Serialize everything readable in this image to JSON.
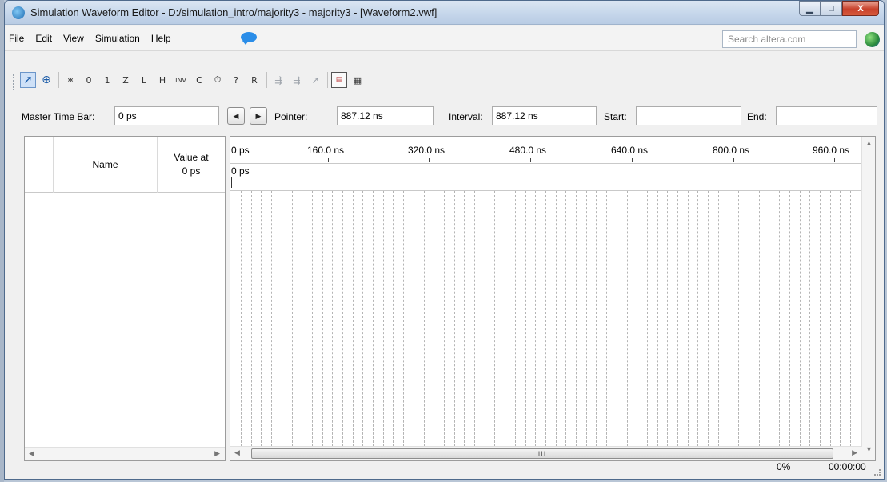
{
  "window": {
    "title": "Simulation Waveform Editor - D:/simulation_intro/majority3 - majority3 - [Waveform2.vwf]",
    "minimize_glyph": "▁",
    "maximize_glyph": "□",
    "close_glyph": "X"
  },
  "menu": {
    "items": [
      {
        "label": "File"
      },
      {
        "label": "Edit"
      },
      {
        "label": "View"
      },
      {
        "label": "Simulation"
      },
      {
        "label": "Help"
      }
    ],
    "search_placeholder": "Search altera.com"
  },
  "toolbar": {
    "tools": [
      {
        "name": "selection-tool",
        "glyph": "➚"
      },
      {
        "name": "zoom-tool",
        "glyph": "⊕"
      },
      {
        "name": "forcing-unknown",
        "glyph": "⨳"
      },
      {
        "name": "forcing-low",
        "glyph": "0"
      },
      {
        "name": "forcing-high",
        "glyph": "1"
      },
      {
        "name": "high-impedance",
        "glyph": "Z"
      },
      {
        "name": "weak-low",
        "glyph": "L"
      },
      {
        "name": "weak-high",
        "glyph": "H"
      },
      {
        "name": "invert",
        "glyph": "INV"
      },
      {
        "name": "count-value",
        "glyph": "C"
      },
      {
        "name": "clock",
        "glyph": "⏱"
      },
      {
        "name": "arbitrary-value",
        "glyph": "?"
      },
      {
        "name": "random-value",
        "glyph": "R"
      },
      {
        "name": "functional-simulation",
        "glyph": "⇶"
      },
      {
        "name": "timing-simulation",
        "glyph": "⇶"
      },
      {
        "name": "netlist-sim",
        "glyph": "↗"
      },
      {
        "name": "simulation-report",
        "glyph": "▤"
      },
      {
        "name": "grid-snap",
        "glyph": "▦"
      }
    ]
  },
  "controls": {
    "master_time_bar_label": "Master Time Bar:",
    "master_time_bar_value": "0 ps",
    "prev_glyph": "◀",
    "next_glyph": "▶",
    "pointer_label": "Pointer:",
    "pointer_value": "887.12 ns",
    "interval_label": "Interval:",
    "interval_value": "887.12 ns",
    "start_label": "Start:",
    "start_value": "",
    "end_label": "End:",
    "end_value": ""
  },
  "signal_list": {
    "name_header": "Name",
    "value_header_line1": "Value at",
    "value_header_line2": "0 ps"
  },
  "waveform": {
    "time_ticks": [
      "0 ps",
      "160.0 ns",
      "320.0 ns",
      "480.0 ns",
      "640.0 ns",
      "800.0 ns",
      "960.0 ns"
    ],
    "cursor_label": "0 ps",
    "scroll_thumb": "III"
  },
  "status": {
    "progress": "0%",
    "elapsed": "00:00:00"
  },
  "colors": {
    "title_gradient_top": "#dbe6f3",
    "close_button": "#c8412b",
    "grid_line": "#b4b4b4",
    "accent": "#2a8de8"
  }
}
